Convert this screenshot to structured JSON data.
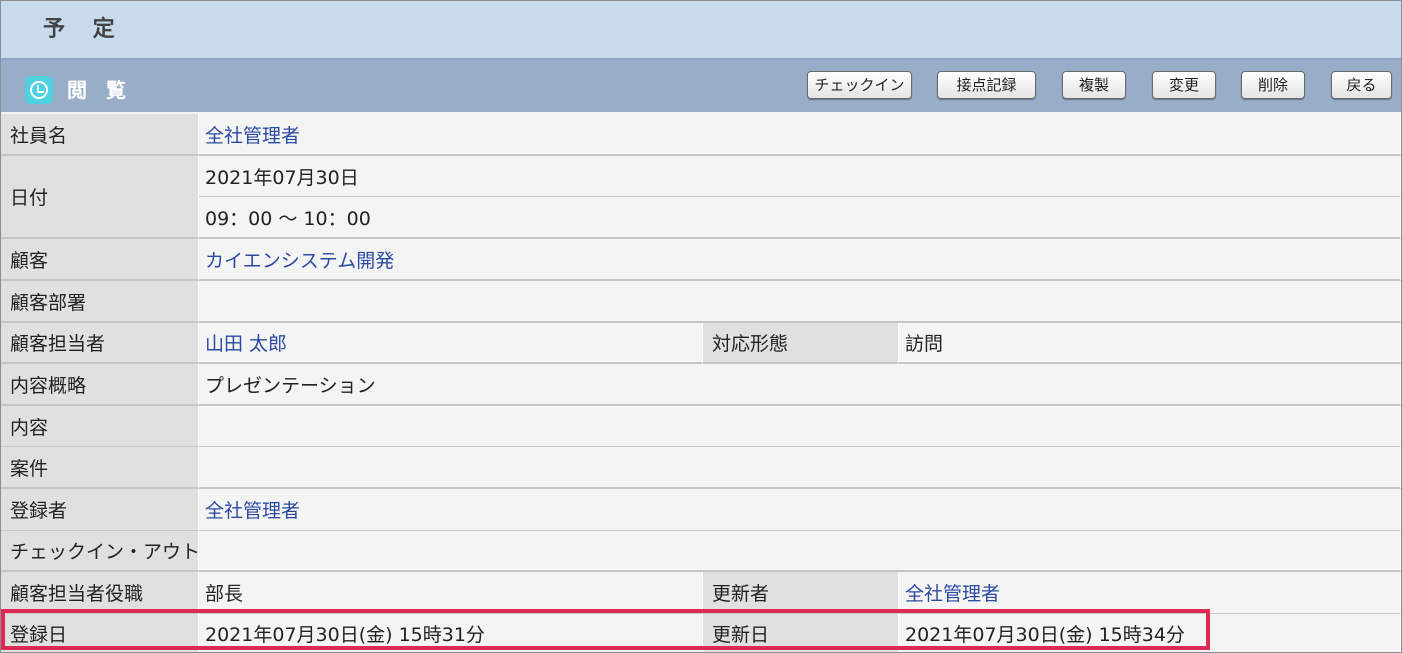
{
  "header": {
    "title": "予 定"
  },
  "section": {
    "title": "閲 覧",
    "icon": "clock-icon",
    "buttons": {
      "checkin": "チェックイン",
      "contact_record": "接点記録",
      "duplicate": "複製",
      "edit": "変更",
      "delete": "削除",
      "back": "戻る"
    }
  },
  "details": {
    "employee": {
      "label": "社員名",
      "value": "全社管理者"
    },
    "date": {
      "label": "日付",
      "day": "2021年07月30日",
      "time": "09：00 〜 10：00"
    },
    "customer": {
      "label": "顧客",
      "value": "カイエンシステム開発"
    },
    "customer_dept": {
      "label": "顧客部署",
      "value": ""
    },
    "customer_contact": {
      "label": "顧客担当者",
      "value": "山田 太郎"
    },
    "response_type": {
      "label": "対応形態",
      "value": "訪問"
    },
    "summary": {
      "label": "内容概略",
      "value": "プレゼンテーション"
    },
    "content": {
      "label": "内容",
      "value": ""
    },
    "project": {
      "label": "案件",
      "value": ""
    },
    "registrant": {
      "label": "登録者",
      "value": "全社管理者"
    },
    "check_in_out": {
      "label": "チェックイン・アウト",
      "value": ""
    },
    "contact_position": {
      "label": "顧客担当者役職",
      "value": "部長"
    },
    "updater": {
      "label": "更新者",
      "value": "全社管理者"
    },
    "registered_at": {
      "label": "登録日",
      "value": "2021年07月30日(金) 15時31分"
    },
    "updated_at": {
      "label": "更新日",
      "value": "2021年07月30日(金) 15時34分"
    }
  },
  "colors": {
    "title_bar": "#c8dbed",
    "section_bar": "#98aec8",
    "link": "#2b4aa2",
    "highlight": "#dd2b56"
  }
}
